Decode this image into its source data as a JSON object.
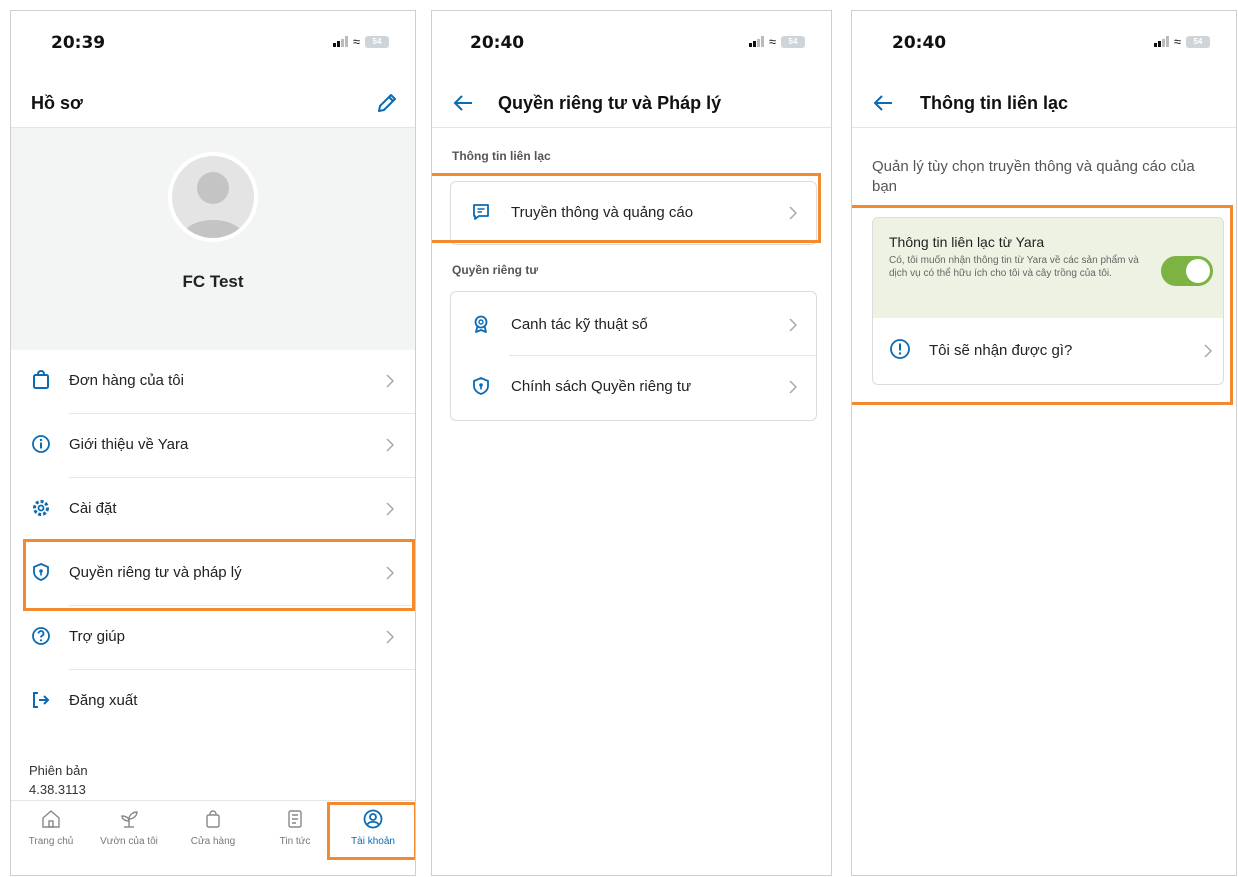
{
  "colors": {
    "accent": "#0b6bb3",
    "highlight": "#f28b30",
    "toggle_on": "#7cb342"
  },
  "screens": [
    {
      "status": {
        "time": "20:39",
        "battery": "54"
      },
      "header": {
        "title": "Hồ sơ",
        "action_icon": "pencil-icon"
      },
      "profile": {
        "name": "FC Test"
      },
      "menu": [
        {
          "label": "Đơn hàng của tôi",
          "icon": "shopping-bag-icon"
        },
        {
          "label": "Giới thiệu về Yara",
          "icon": "info-circle-icon"
        },
        {
          "label": "Cài đặt",
          "icon": "gear-icon"
        },
        {
          "label": "Quyền riêng tư và pháp lý",
          "icon": "shield-icon"
        },
        {
          "label": "Trợ giúp",
          "icon": "question-circle-icon"
        },
        {
          "label": "Đăng xuất",
          "icon": "logout-icon"
        }
      ],
      "version": {
        "label": "Phiên bản",
        "value": "4.38.3113"
      },
      "tabs": [
        {
          "label": "Trang chủ",
          "icon": "home-icon"
        },
        {
          "label": "Vườn của tôi",
          "icon": "plant-icon"
        },
        {
          "label": "Cửa hàng",
          "icon": "shopping-bag-icon"
        },
        {
          "label": "Tin tức",
          "icon": "news-icon"
        },
        {
          "label": "Tài khoản",
          "icon": "account-icon",
          "active": true
        }
      ]
    },
    {
      "status": {
        "time": "20:40",
        "battery": "54"
      },
      "header": {
        "title": "Quyền riêng tư và Pháp lý"
      },
      "sections": [
        {
          "title": "Thông tin liên lạc",
          "items": [
            {
              "label": "Truyền thông và quảng cáo",
              "icon": "message-icon"
            }
          ]
        },
        {
          "title": "Quyền riêng tư",
          "items": [
            {
              "label": "Canh tác kỹ thuật số",
              "icon": "award-icon"
            },
            {
              "label": "Chính sách Quyền riêng tư",
              "icon": "shield-icon"
            }
          ]
        }
      ]
    },
    {
      "status": {
        "time": "20:40",
        "battery": "54"
      },
      "header": {
        "title": "Thông tin liên lạc"
      },
      "intro": "Quản lý tùy chọn truyền thông và quảng cáo của bạn",
      "preference": {
        "title": "Thông tin liên lạc từ Yara",
        "description": "Có, tôi muốn nhận thông tin từ Yara về các sản phẩm và dịch vụ có thể hữu ích cho tôi và cây trồng của tôi.",
        "enabled": true
      },
      "info_row": {
        "label": "Tôi sẽ nhận được gì?",
        "icon": "alert-circle-icon"
      }
    }
  ]
}
